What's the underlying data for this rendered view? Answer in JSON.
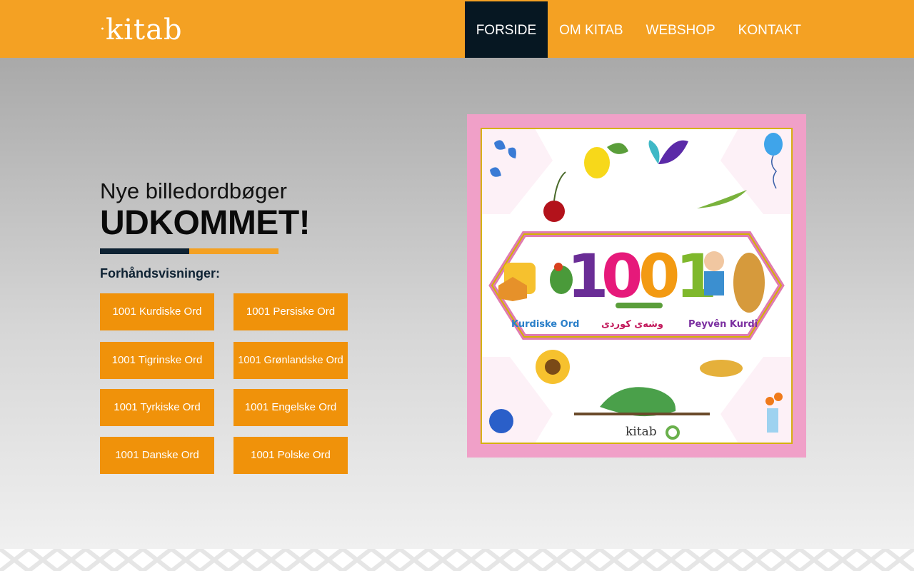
{
  "brand": {
    "logo_text": "kitab",
    "accent": "#f4a123",
    "dark": "#061722",
    "button": "#f0920a"
  },
  "nav": [
    {
      "label": "FORSIDE",
      "active": true
    },
    {
      "label": "OM KITAB",
      "active": false
    },
    {
      "label": "WEBSHOP",
      "active": false
    },
    {
      "label": "KONTAKT",
      "active": false
    }
  ],
  "hero": {
    "subtitle": "Nye billedordbøger",
    "headline": "UDKOMMET!",
    "preview_label": "Forhåndsvisninger:",
    "buttons": [
      "1001 Kurdiske Ord",
      "1001 Persiske Ord",
      "1001 Tigrinske Ord",
      "1001 Grønlandske Ord",
      "1001 Tyrkiske Ord",
      "1001 Engelske Ord",
      "1001 Danske Ord",
      "1001 Polske Ord"
    ]
  },
  "cover": {
    "number": "1001",
    "caption_left": "Kurdiske Ord",
    "caption_mid": "وشەی کوردی",
    "caption_right": "Peyvên Kurdî",
    "logo": "kitab"
  }
}
